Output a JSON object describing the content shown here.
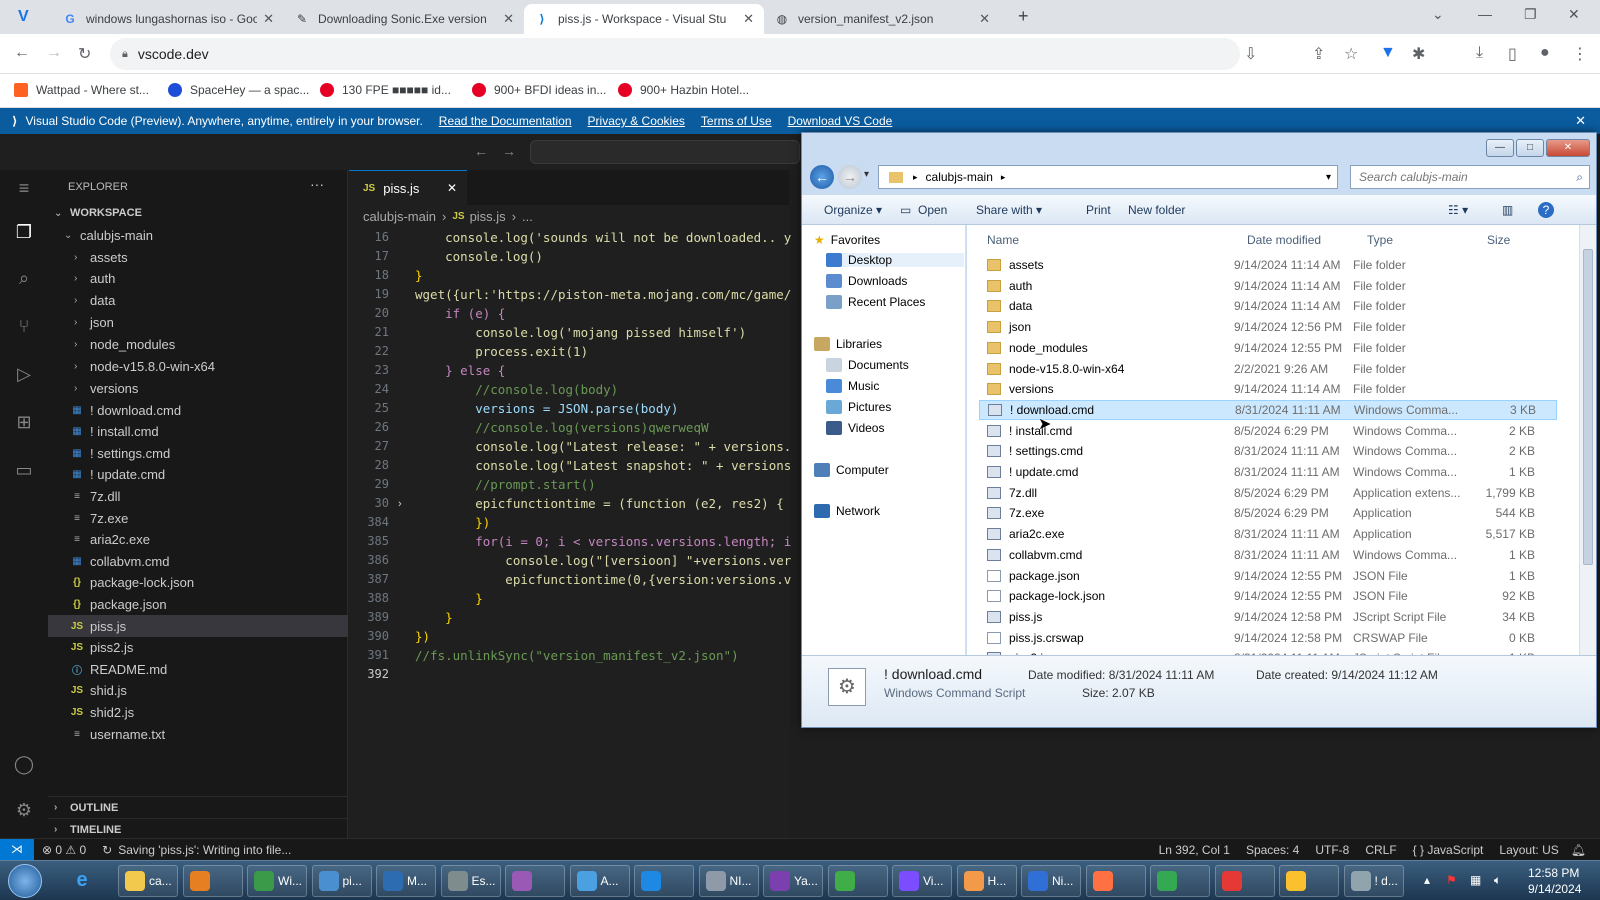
{
  "browser": {
    "tabs": [
      {
        "title": "windows lungashornas iso - Goo",
        "icon": "google-icon"
      },
      {
        "title": "Downloading Sonic.Exe version",
        "icon": "pen-icon"
      },
      {
        "title": "piss.js - Workspace - Visual Stu",
        "icon": "vscode-icon"
      },
      {
        "title": "version_manifest_v2.json",
        "icon": "globe-icon"
      }
    ],
    "address": "vscode.dev",
    "bookmarks": [
      "Wattpad - Where st...",
      "SpaceHey — a spac...",
      "130 FPE ■■■■■ id...",
      "900+ BFDI ideas in...",
      "900+ Hazbin Hotel..."
    ]
  },
  "banner": {
    "text": "Visual Studio Code (Preview). Anywhere, anytime, entirely in your browser.",
    "links": [
      "Read the Documentation",
      "Privacy & Cookies",
      "Terms of Use",
      "Download VS Code"
    ]
  },
  "sidebar": {
    "title": "EXPLORER",
    "workspace": "WORKSPACE",
    "root": "calubjs-main",
    "folders": [
      "assets",
      "auth",
      "data",
      "json",
      "node_modules",
      "node-v15.8.0-win-x64",
      "versions"
    ],
    "files": [
      {
        "name": "! download.cmd",
        "icon": "cmd"
      },
      {
        "name": "! install.cmd",
        "icon": "cmd"
      },
      {
        "name": "! settings.cmd",
        "icon": "cmd"
      },
      {
        "name": "! update.cmd",
        "icon": "cmd"
      },
      {
        "name": "7z.dll",
        "icon": "txt"
      },
      {
        "name": "7z.exe",
        "icon": "txt"
      },
      {
        "name": "aria2c.exe",
        "icon": "txt"
      },
      {
        "name": "collabvm.cmd",
        "icon": "cmd"
      },
      {
        "name": "package-lock.json",
        "icon": "json"
      },
      {
        "name": "package.json",
        "icon": "json"
      },
      {
        "name": "piss.js",
        "icon": "js"
      },
      {
        "name": "piss2.js",
        "icon": "js"
      },
      {
        "name": "README.md",
        "icon": "info"
      },
      {
        "name": "shid.js",
        "icon": "js"
      },
      {
        "name": "shid2.js",
        "icon": "js"
      },
      {
        "name": "username.txt",
        "icon": "txt"
      }
    ],
    "outline": "OUTLINE",
    "timeline": "TIMELINE"
  },
  "editor": {
    "tab": "piss.js",
    "breadcrumb": [
      "calubjs-main",
      "piss.js",
      "..."
    ],
    "lines": [
      {
        "n": "16",
        "text": "    console.log('sounds will not be downloaded.. y"
      },
      {
        "n": "17",
        "text": "    console.log()"
      },
      {
        "n": "18",
        "text": "}"
      },
      {
        "n": "19",
        "text": "wget({url:'https://piston-meta.mojang.com/mc/game/"
      },
      {
        "n": "20",
        "text": "    if (e) {"
      },
      {
        "n": "21",
        "text": "        console.log('mojang pissed himself')"
      },
      {
        "n": "22",
        "text": "        process.exit(1)"
      },
      {
        "n": "23",
        "text": "    } else {"
      },
      {
        "n": "24",
        "text": "        //console.log(body)"
      },
      {
        "n": "25",
        "text": "        versions = JSON.parse(body)"
      },
      {
        "n": "26",
        "text": "        //console.log(versions)qwerweqW"
      },
      {
        "n": "27",
        "text": "        console.log(\"Latest release: \" + versions."
      },
      {
        "n": "28",
        "text": "        console.log(\"Latest snapshot: \" + versions"
      },
      {
        "n": "29",
        "text": "        //prompt.start()"
      },
      {
        "n": "30",
        "text": "        epicfunctiontime = (function (e2, res2) {"
      },
      {
        "n": "384",
        "text": "        })"
      },
      {
        "n": "385",
        "text": "        for(i = 0; i < versions.versions.length; i"
      },
      {
        "n": "386",
        "text": "            console.log(\"[versioon] \"+versions.ver"
      },
      {
        "n": "387",
        "text": "            epicfunctiontime(0,{version:versions.v"
      },
      {
        "n": "388",
        "text": "        }"
      },
      {
        "n": "389",
        "text": "    }"
      },
      {
        "n": "390",
        "text": "})"
      },
      {
        "n": "391",
        "text": "//fs.unlinkSync(\"version_manifest_v2.json\")"
      },
      {
        "n": "392",
        "text": ""
      }
    ]
  },
  "statusbar": {
    "problems": "⊗ 0 ⚠ 0",
    "saving": "Saving 'piss.js': Writing into file...",
    "position": "Ln 392, Col 1",
    "spaces": "Spaces: 4",
    "encoding": "UTF-8",
    "eol": "CRLF",
    "language": "{ } JavaScript",
    "layout": "Layout: US"
  },
  "explorer_window": {
    "path": "calubjs-main",
    "search_placeholder": "Search calubjs-main",
    "commands": [
      "Organize ▾",
      "Open",
      "Share with ▾",
      "Print",
      "New folder"
    ],
    "nav": {
      "favorites": "Favorites",
      "favorite_items": [
        "Desktop",
        "Downloads",
        "Recent Places"
      ],
      "libraries": "Libraries",
      "library_items": [
        "Documents",
        "Music",
        "Pictures",
        "Videos"
      ],
      "computer": "Computer",
      "network": "Network"
    },
    "columns": [
      "Name",
      "Date modified",
      "Type",
      "Size"
    ],
    "rows": [
      {
        "name": "assets",
        "date": "9/14/2024 11:14 AM",
        "type": "File folder",
        "size": "",
        "kind": "folder"
      },
      {
        "name": "auth",
        "date": "9/14/2024 11:14 AM",
        "type": "File folder",
        "size": "",
        "kind": "folder"
      },
      {
        "name": "data",
        "date": "9/14/2024 11:14 AM",
        "type": "File folder",
        "size": "",
        "kind": "folder"
      },
      {
        "name": "json",
        "date": "9/14/2024 12:56 PM",
        "type": "File folder",
        "size": "",
        "kind": "folder"
      },
      {
        "name": "node_modules",
        "date": "9/14/2024 12:55 PM",
        "type": "File folder",
        "size": "",
        "kind": "folder"
      },
      {
        "name": "node-v15.8.0-win-x64",
        "date": "2/2/2021 9:26 AM",
        "type": "File folder",
        "size": "",
        "kind": "folder"
      },
      {
        "name": "versions",
        "date": "9/14/2024 11:14 AM",
        "type": "File folder",
        "size": "",
        "kind": "folder"
      },
      {
        "name": "! download.cmd",
        "date": "8/31/2024 11:11 AM",
        "type": "Windows Comma...",
        "size": "3 KB",
        "kind": "cmd"
      },
      {
        "name": "! install.cmd",
        "date": "8/5/2024 6:29 PM",
        "type": "Windows Comma...",
        "size": "2 KB",
        "kind": "cmd"
      },
      {
        "name": "! settings.cmd",
        "date": "8/31/2024 11:11 AM",
        "type": "Windows Comma...",
        "size": "2 KB",
        "kind": "cmd"
      },
      {
        "name": "! update.cmd",
        "date": "8/31/2024 11:11 AM",
        "type": "Windows Comma...",
        "size": "1 KB",
        "kind": "cmd"
      },
      {
        "name": "7z.dll",
        "date": "8/5/2024 6:29 PM",
        "type": "Application extens...",
        "size": "1,799 KB",
        "kind": "cmd"
      },
      {
        "name": "7z.exe",
        "date": "8/5/2024 6:29 PM",
        "type": "Application",
        "size": "544 KB",
        "kind": "cmd"
      },
      {
        "name": "aria2c.exe",
        "date": "8/31/2024 11:11 AM",
        "type": "Application",
        "size": "5,517 KB",
        "kind": "cmd"
      },
      {
        "name": "collabvm.cmd",
        "date": "8/31/2024 11:11 AM",
        "type": "Windows Comma...",
        "size": "1 KB",
        "kind": "cmd"
      },
      {
        "name": "package.json",
        "date": "9/14/2024 12:55 PM",
        "type": "JSON File",
        "size": "1 KB",
        "kind": "file"
      },
      {
        "name": "package-lock.json",
        "date": "9/14/2024 12:55 PM",
        "type": "JSON File",
        "size": "92 KB",
        "kind": "file"
      },
      {
        "name": "piss.js",
        "date": "9/14/2024 12:58 PM",
        "type": "JScript Script File",
        "size": "34 KB",
        "kind": "cmd"
      },
      {
        "name": "piss.js.crswap",
        "date": "9/14/2024 12:58 PM",
        "type": "CRSWAP File",
        "size": "0 KB",
        "kind": "file"
      },
      {
        "name": "piss2.js",
        "date": "8/31/2024 11:11 AM",
        "type": "JScript Script File",
        "size": "1 KB",
        "kind": "cmd"
      }
    ],
    "selected_index": 7,
    "details": {
      "name": "! download.cmd",
      "kind": "Windows Command Script",
      "modified": "Date modified: 8/31/2024 11:11 AM",
      "size": "Size: 2.07 KB",
      "created": "Date created: 9/14/2024 11:12 AM"
    }
  },
  "taskbar": {
    "items": [
      "ca...",
      "",
      "Wi...",
      "pi...",
      "M...",
      "Es...",
      "",
      "A...",
      "",
      "NI...",
      "Ya...",
      "",
      "Vi...",
      "H...",
      "Ni...",
      "",
      "",
      "",
      "",
      "! d..."
    ],
    "time": "12:58 PM",
    "date": "9/14/2024"
  }
}
